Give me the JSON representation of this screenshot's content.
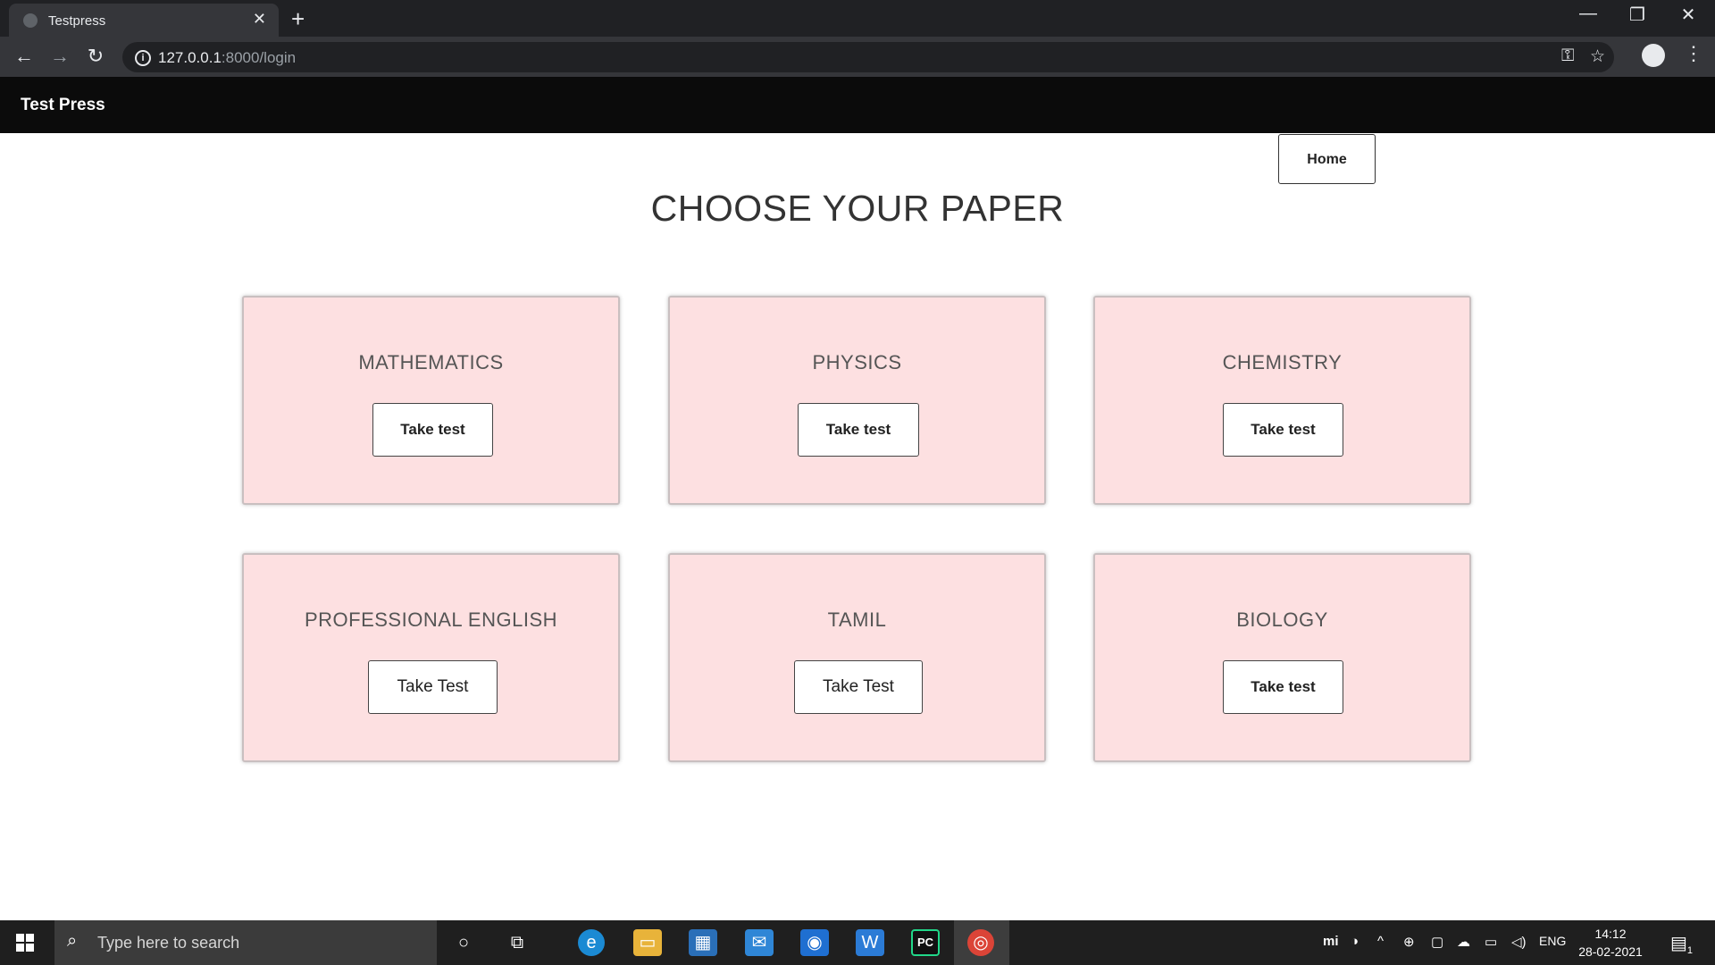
{
  "browser": {
    "tab_title": "Testpress",
    "url_host": "127.0.0.1",
    "url_path": ":8000/login"
  },
  "app": {
    "brand": "Test Press",
    "home_label": "Home",
    "title": "CHOOSE YOUR PAPER"
  },
  "cards": [
    {
      "title": "MATHEMATICS",
      "button": "Take test"
    },
    {
      "title": "PHYSICS",
      "button": "Take test"
    },
    {
      "title": "CHEMISTRY",
      "button": "Take test"
    },
    {
      "title": "PROFESSIONAL ENGLISH",
      "button": "Take Test"
    },
    {
      "title": "TAMIL",
      "button": "Take Test"
    },
    {
      "title": "BIOLOGY",
      "button": "Take test"
    }
  ],
  "taskbar": {
    "search_placeholder": "Type here to search",
    "language": "ENG",
    "time": "14:12",
    "date": "28-02-2021",
    "notification_count": "1"
  },
  "colors": {
    "card_bg": "#fde0e1",
    "navbar_bg": "#0b0b0b"
  }
}
